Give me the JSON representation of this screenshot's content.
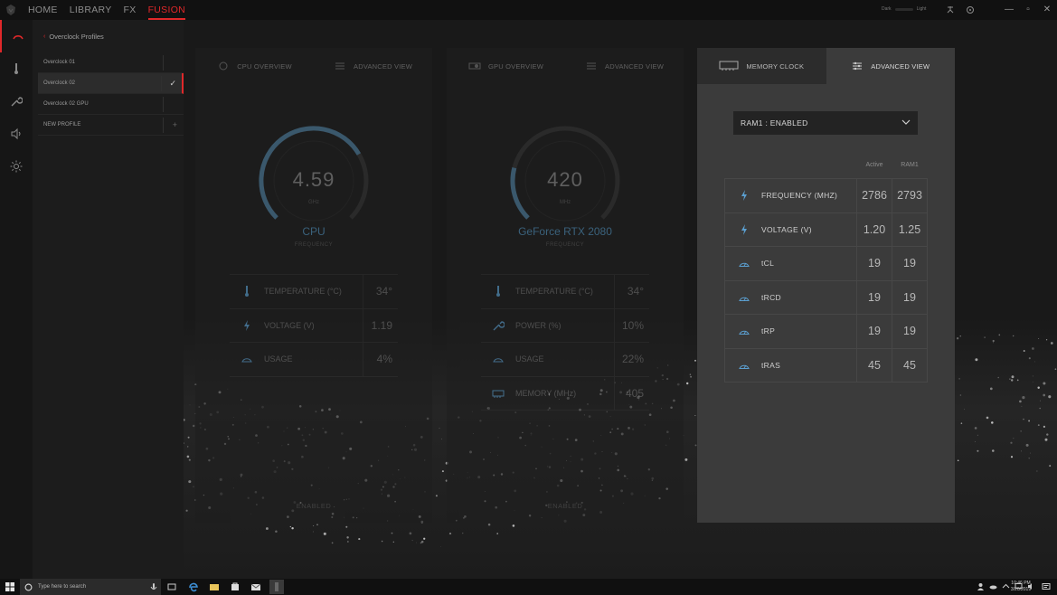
{
  "topnav": {
    "items": [
      "HOME",
      "LIBRARY",
      "FX",
      "FUSION"
    ],
    "active": "FUSION",
    "theme_dark": "Dark",
    "theme_light": "Light"
  },
  "profiles": {
    "title": "Overclock Profiles",
    "items": [
      "Overclock 01",
      "Overclock 02",
      "Overclock 02 GPU"
    ],
    "selected": "Overclock 02",
    "new_label": "NEW PROFILE"
  },
  "cpu": {
    "tab_overview": "CPU OVERVIEW",
    "tab_advanced": "ADVANCED VIEW",
    "gauge_value": "4.59",
    "gauge_unit": "GHz",
    "gauge_level": 0.72,
    "name": "CPU",
    "sub": "FREQUENCY",
    "stats": [
      {
        "icon": "thermometer-icon",
        "label": "TEMPERATURE (°C)",
        "value": "34°"
      },
      {
        "icon": "lightning-icon",
        "label": "VOLTAGE (V)",
        "value": "1.19"
      },
      {
        "icon": "speedometer-icon",
        "label": "USAGE",
        "value": "4%"
      }
    ],
    "footer": "ENABLED"
  },
  "gpu": {
    "tab_overview": "GPU OVERVIEW",
    "tab_advanced": "ADVANCED VIEW",
    "gauge_value": "420",
    "gauge_unit": "MHz",
    "gauge_level": 0.22,
    "name": "GeForce RTX 2080",
    "sub": "FREQUENCY",
    "stats": [
      {
        "icon": "thermometer-icon",
        "label": "TEMPERATURE (°C)",
        "value": "34°"
      },
      {
        "icon": "wrench-icon",
        "label": "POWER (%)",
        "value": "10%"
      },
      {
        "icon": "speedometer-icon",
        "label": "USAGE",
        "value": "22%"
      },
      {
        "icon": "memory-card-icon",
        "label": "MEMORY (MHz)",
        "value": "405"
      }
    ],
    "footer": "ENABLED"
  },
  "memory": {
    "tab_clock": "MEMORY CLOCK",
    "tab_advanced": "ADVANCED VIEW",
    "dropdown": "RAM1 : ENABLED",
    "col_active": "Active",
    "col_ram": "RAM1",
    "rows": [
      {
        "icon": "lightning-icon",
        "label": "FREQUENCY (MHZ)",
        "active": "2786",
        "ram": "2793"
      },
      {
        "icon": "lightning-icon",
        "label": "VOLTAGE (V)",
        "active": "1.20",
        "ram": "1.25"
      },
      {
        "icon": "speedometer-icon",
        "label": "tCL",
        "active": "19",
        "ram": "19"
      },
      {
        "icon": "speedometer-icon",
        "label": "tRCD",
        "active": "19",
        "ram": "19"
      },
      {
        "icon": "speedometer-icon",
        "label": "tRP",
        "active": "19",
        "ram": "19"
      },
      {
        "icon": "speedometer-icon",
        "label": "tRAS",
        "active": "45",
        "ram": "45"
      }
    ]
  },
  "taskbar": {
    "search_placeholder": "Type here to search",
    "time": "10:46 PM",
    "date": "3/20/2019"
  },
  "colors": {
    "accent": "#e0282a",
    "gauge_blue": "#4f8eb8",
    "icon_blue": "#5b9fd0"
  }
}
